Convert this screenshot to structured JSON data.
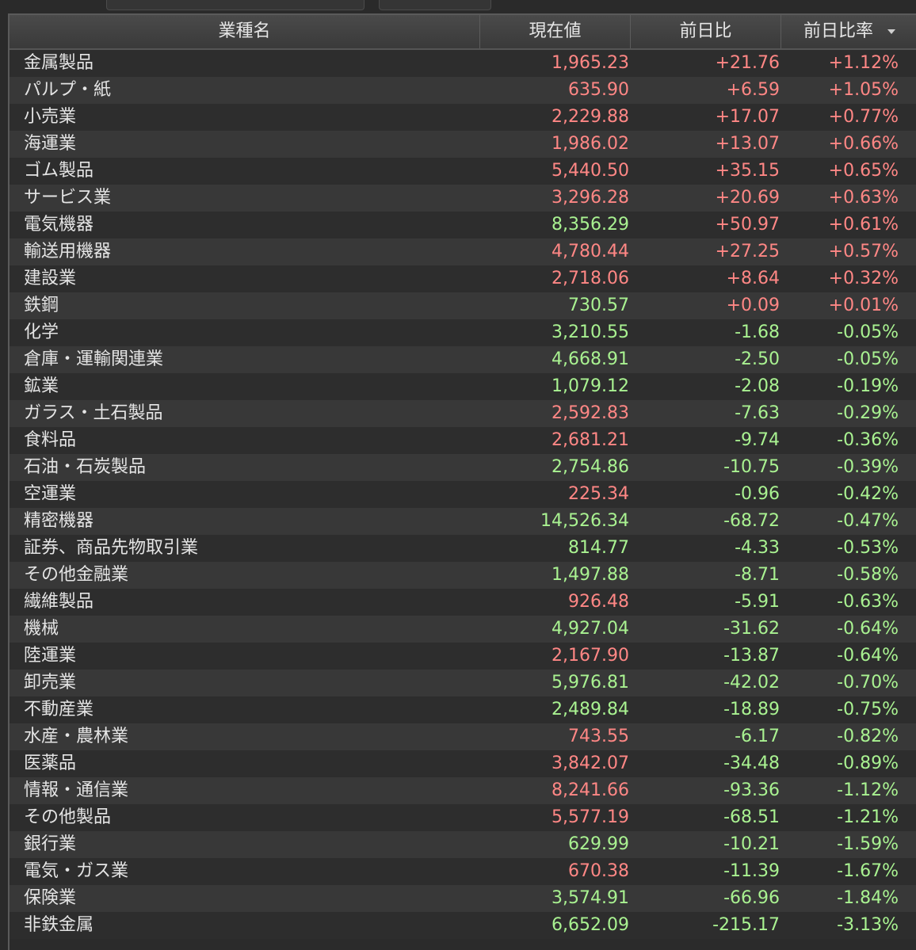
{
  "header": {
    "name": "業種名",
    "price": "現在値",
    "change": "前日比",
    "change_rate": "前日比率"
  },
  "colors": {
    "up": "#ff8785",
    "down": "#a9f291"
  },
  "rows": [
    {
      "name": "金属製品",
      "price": "1,965.23",
      "price_dir": "up",
      "change": "+21.76",
      "change_rate": "+1.12%"
    },
    {
      "name": "パルプ・紙",
      "price": "635.90",
      "price_dir": "up",
      "change": "+6.59",
      "change_rate": "+1.05%"
    },
    {
      "name": "小売業",
      "price": "2,229.88",
      "price_dir": "up",
      "change": "+17.07",
      "change_rate": "+0.77%"
    },
    {
      "name": "海運業",
      "price": "1,986.02",
      "price_dir": "up",
      "change": "+13.07",
      "change_rate": "+0.66%"
    },
    {
      "name": "ゴム製品",
      "price": "5,440.50",
      "price_dir": "up",
      "change": "+35.15",
      "change_rate": "+0.65%"
    },
    {
      "name": "サービス業",
      "price": "3,296.28",
      "price_dir": "up",
      "change": "+20.69",
      "change_rate": "+0.63%"
    },
    {
      "name": "電気機器",
      "price": "8,356.29",
      "price_dir": "down",
      "change": "+50.97",
      "change_rate": "+0.61%"
    },
    {
      "name": "輸送用機器",
      "price": "4,780.44",
      "price_dir": "up",
      "change": "+27.25",
      "change_rate": "+0.57%"
    },
    {
      "name": "建設業",
      "price": "2,718.06",
      "price_dir": "up",
      "change": "+8.64",
      "change_rate": "+0.32%"
    },
    {
      "name": "鉄鋼",
      "price": "730.57",
      "price_dir": "down",
      "change": "+0.09",
      "change_rate": "+0.01%"
    },
    {
      "name": "化学",
      "price": "3,210.55",
      "price_dir": "down",
      "change": "-1.68",
      "change_rate": "-0.05%"
    },
    {
      "name": "倉庫・運輸関連業",
      "price": "4,668.91",
      "price_dir": "down",
      "change": "-2.50",
      "change_rate": "-0.05%"
    },
    {
      "name": "鉱業",
      "price": "1,079.12",
      "price_dir": "down",
      "change": "-2.08",
      "change_rate": "-0.19%"
    },
    {
      "name": "ガラス・土石製品",
      "price": "2,592.83",
      "price_dir": "up",
      "change": "-7.63",
      "change_rate": "-0.29%"
    },
    {
      "name": "食料品",
      "price": "2,681.21",
      "price_dir": "up",
      "change": "-9.74",
      "change_rate": "-0.36%"
    },
    {
      "name": "石油・石炭製品",
      "price": "2,754.86",
      "price_dir": "down",
      "change": "-10.75",
      "change_rate": "-0.39%"
    },
    {
      "name": "空運業",
      "price": "225.34",
      "price_dir": "up",
      "change": "-0.96",
      "change_rate": "-0.42%"
    },
    {
      "name": "精密機器",
      "price": "14,526.34",
      "price_dir": "down",
      "change": "-68.72",
      "change_rate": "-0.47%"
    },
    {
      "name": "証券、商品先物取引業",
      "price": "814.77",
      "price_dir": "down",
      "change": "-4.33",
      "change_rate": "-0.53%"
    },
    {
      "name": "その他金融業",
      "price": "1,497.88",
      "price_dir": "down",
      "change": "-8.71",
      "change_rate": "-0.58%"
    },
    {
      "name": "繊維製品",
      "price": "926.48",
      "price_dir": "up",
      "change": "-5.91",
      "change_rate": "-0.63%"
    },
    {
      "name": "機械",
      "price": "4,927.04",
      "price_dir": "down",
      "change": "-31.62",
      "change_rate": "-0.64%"
    },
    {
      "name": "陸運業",
      "price": "2,167.90",
      "price_dir": "up",
      "change": "-13.87",
      "change_rate": "-0.64%"
    },
    {
      "name": "卸売業",
      "price": "5,976.81",
      "price_dir": "down",
      "change": "-42.02",
      "change_rate": "-0.70%"
    },
    {
      "name": "不動産業",
      "price": "2,489.84",
      "price_dir": "down",
      "change": "-18.89",
      "change_rate": "-0.75%"
    },
    {
      "name": "水産・農林業",
      "price": "743.55",
      "price_dir": "up",
      "change": "-6.17",
      "change_rate": "-0.82%"
    },
    {
      "name": "医薬品",
      "price": "3,842.07",
      "price_dir": "up",
      "change": "-34.48",
      "change_rate": "-0.89%"
    },
    {
      "name": "情報・通信業",
      "price": "8,241.66",
      "price_dir": "up",
      "change": "-93.36",
      "change_rate": "-1.12%"
    },
    {
      "name": "その他製品",
      "price": "5,577.19",
      "price_dir": "up",
      "change": "-68.51",
      "change_rate": "-1.21%"
    },
    {
      "name": "銀行業",
      "price": "629.99",
      "price_dir": "down",
      "change": "-10.21",
      "change_rate": "-1.59%"
    },
    {
      "name": "電気・ガス業",
      "price": "670.38",
      "price_dir": "up",
      "change": "-11.39",
      "change_rate": "-1.67%"
    },
    {
      "name": "保険業",
      "price": "3,574.91",
      "price_dir": "down",
      "change": "-66.96",
      "change_rate": "-1.84%"
    },
    {
      "name": "非鉄金属",
      "price": "6,652.09",
      "price_dir": "down",
      "change": "-215.17",
      "change_rate": "-3.13%"
    }
  ]
}
